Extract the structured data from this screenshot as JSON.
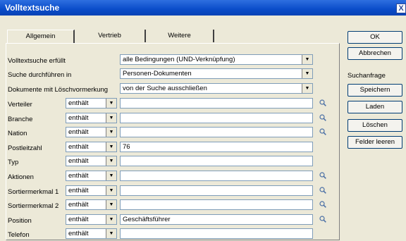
{
  "window": {
    "title": "Volltextsuche",
    "close": "X"
  },
  "tabs": [
    "Allgemein",
    "Vertrieb",
    "Weitere"
  ],
  "general": [
    {
      "label": "Volltextsuche erfüllt",
      "value": "alle Bedingungen (UND-Verknüpfung)"
    },
    {
      "label": "Suche durchführen in",
      "value": "Personen-Dokumenten"
    },
    {
      "label": "Dokumente mit Löschvormerkung",
      "value": "von der Suche ausschließen"
    }
  ],
  "fields": [
    {
      "label": "Verteiler",
      "op": "enthält",
      "value": "",
      "lookup": true
    },
    {
      "label": "Branche",
      "op": "enthält",
      "value": "",
      "lookup": true
    },
    {
      "label": "Nation",
      "op": "enthält",
      "value": "",
      "lookup": true
    },
    {
      "label": "Postleitzahl",
      "op": "enthält",
      "value": "76",
      "lookup": false
    },
    {
      "label": "Typ",
      "op": "enthält",
      "value": "",
      "lookup": false
    },
    {
      "label": "Aktionen",
      "op": "enthält",
      "value": "",
      "lookup": true
    },
    {
      "label": "Sortiermerkmal 1",
      "op": "enthält",
      "value": "",
      "lookup": true
    },
    {
      "label": "Sortiermerkmal 2",
      "op": "enthält",
      "value": "",
      "lookup": true
    },
    {
      "label": "Position",
      "op": "enthält",
      "value": "Geschäftsführer",
      "lookup": true
    },
    {
      "label": "Telefon",
      "op": "enthält",
      "value": "",
      "lookup": false
    }
  ],
  "buttons": {
    "ok": "OK",
    "cancel": "Abbrechen",
    "query_label": "Suchanfrage",
    "save": "Speichern",
    "load": "Laden",
    "delete": "Löschen",
    "clear": "Felder leeren"
  }
}
